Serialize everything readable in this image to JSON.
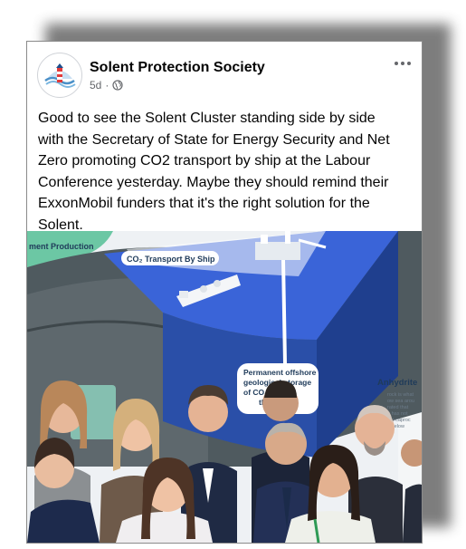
{
  "post": {
    "page_name": "Solent Protection Society",
    "timestamp": "5d",
    "separator": "·",
    "privacy_icon": "globe-icon",
    "more_icon": "more-horizontal-icon",
    "text": "Good to see the Solent Cluster standing side by side\nwith the Secretary of State for Energy Security and Net\nZero promoting CO2 transport by ship at the Labour\nConference yesterday.  Maybe they should remind their\nExxonMobil funders that it's the right solution for the\nSolent."
  },
  "photo": {
    "banner_corner_text": "ment Production",
    "ship_label": "CO₂ Transport By Ship",
    "callout_line1": "Permanent offshore",
    "callout_line2": "geological storage",
    "callout_line3": "of CO₂ 1-…    w",
    "callout_line4": "the s…",
    "side_title": "Anhydrite",
    "side_line1": "rock is what",
    "side_line2": "ow sea arou",
    "side_line3": "rated that",
    "side_line4": "e has not",
    "side_line5": "ent caproc",
    "side_line6": "d below",
    "colors": {
      "sky": "#eef1f4",
      "sea_top": "#3a64d8",
      "sea_side": "#2a4fa8",
      "rock": "#4f5a5f",
      "green": "#6cc7a4"
    }
  }
}
